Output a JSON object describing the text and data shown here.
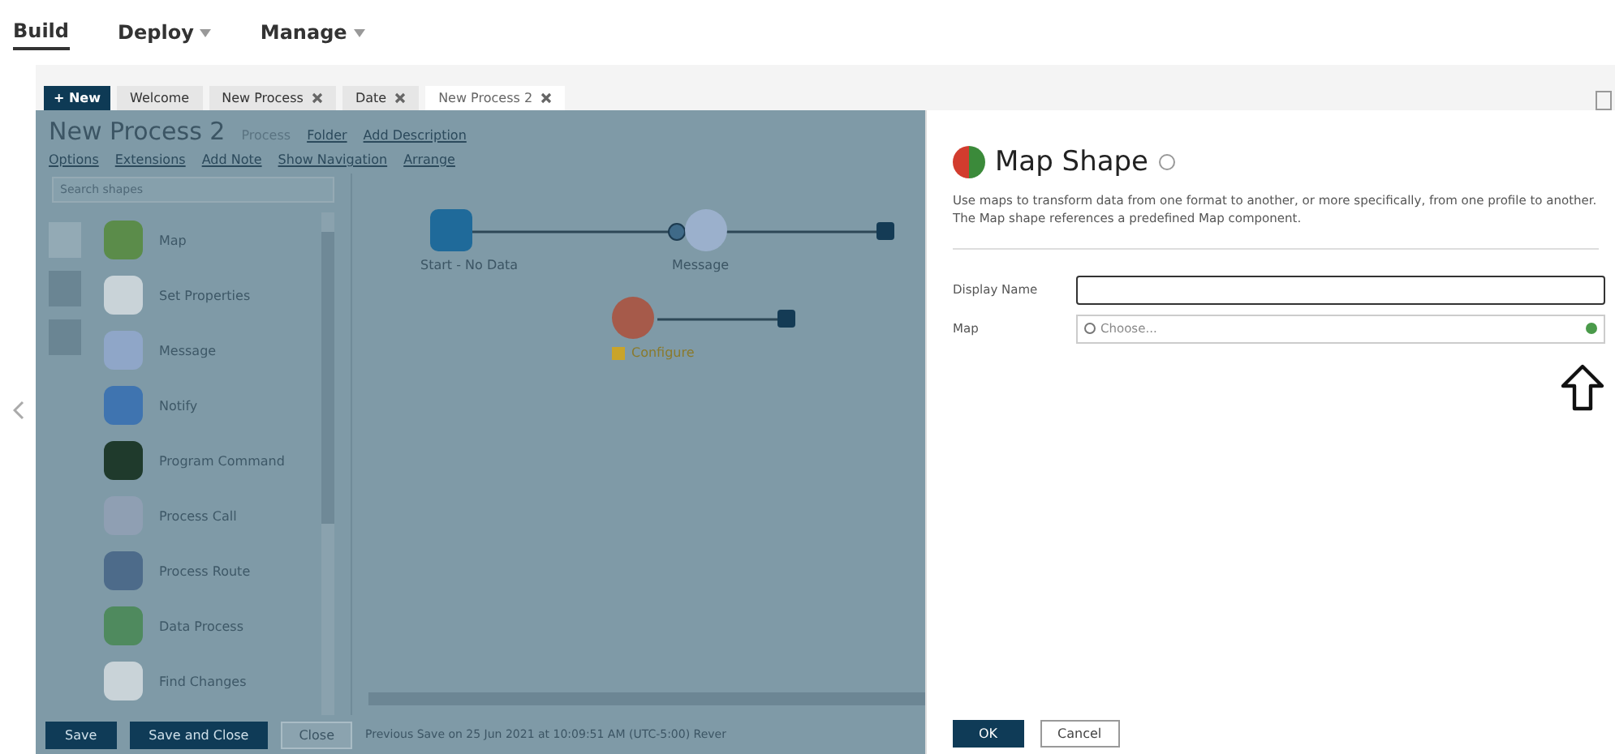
{
  "nav": [
    {
      "label": "Build",
      "selected": true,
      "dropdown": false
    },
    {
      "label": "Deploy",
      "selected": false,
      "dropdown": true
    },
    {
      "label": "Manage",
      "selected": false,
      "dropdown": true
    }
  ],
  "tabs": {
    "new_button": "+ New",
    "items": [
      {
        "label": "Welcome",
        "closable": false,
        "selected": false
      },
      {
        "label": "New Process",
        "closable": true,
        "selected": false
      },
      {
        "label": "Date",
        "closable": true,
        "selected": false
      },
      {
        "label": "New Process 2",
        "closable": true,
        "selected": true
      }
    ]
  },
  "process": {
    "title": "New Process 2",
    "type": "Process",
    "links": [
      "Folder",
      "Add Description"
    ],
    "toolbar": [
      "Options",
      "Extensions",
      "Add Note",
      "Show Navigation",
      "Arrange"
    ]
  },
  "palette": {
    "search_placeholder": "Search shapes",
    "shapes": [
      {
        "label": "Map",
        "kind": "map"
      },
      {
        "label": "Set Properties",
        "kind": "doc"
      },
      {
        "label": "Message",
        "kind": "message"
      },
      {
        "label": "Notify",
        "kind": "notify"
      },
      {
        "label": "Program Command",
        "kind": "terminal"
      },
      {
        "label": "Process Call",
        "kind": "gears"
      },
      {
        "label": "Process Route",
        "kind": "route"
      },
      {
        "label": "Data Process",
        "kind": "data"
      },
      {
        "label": "Find Changes",
        "kind": "doc"
      }
    ]
  },
  "canvas": {
    "nodes": [
      {
        "label": "Start - No Data",
        "kind": "start"
      },
      {
        "label": "Message",
        "kind": "message"
      },
      {
        "label": "Configure",
        "kind": "map"
      }
    ]
  },
  "footer": {
    "buttons": [
      "Save",
      "Save and Close"
    ],
    "close": "Close",
    "status": "Previous Save on 25 Jun 2021 at 10:09:51 AM (UTC-5:00)   Rever"
  },
  "dialog": {
    "title": "Map Shape",
    "description": "Use maps to transform data from one format to another, or more specifically, from one profile to another. The Map shape references a predefined Map component.",
    "fields": [
      {
        "label": "Display Name",
        "kind": "text"
      },
      {
        "label": "Map",
        "kind": "search",
        "placeholder": "Choose..."
      }
    ],
    "buttons": [
      {
        "label": "OK",
        "primary": true
      },
      {
        "label": "Cancel",
        "primary": false
      }
    ]
  }
}
